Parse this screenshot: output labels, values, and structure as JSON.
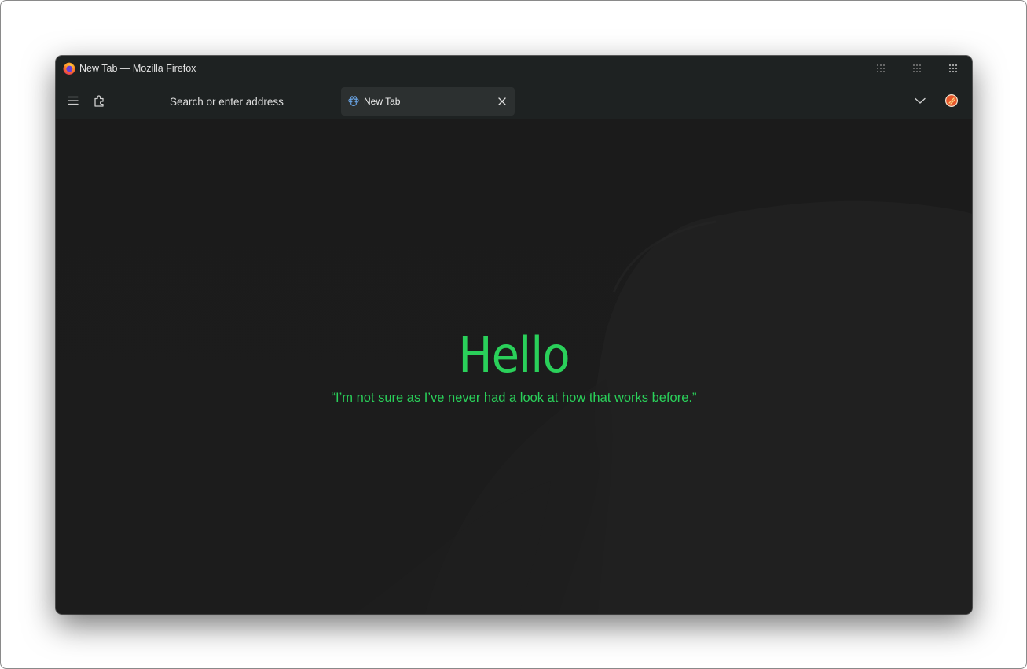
{
  "window": {
    "title": "New Tab — Mozilla Firefox"
  },
  "toolbar": {
    "menu_icon": "hamburger-icon",
    "extensions_icon": "puzzle-icon",
    "url_placeholder": "Search or enter address",
    "list_tabs_icon": "chevron-down-icon",
    "account_icon": "firefox-account-icon"
  },
  "tabs": [
    {
      "label": "New Tab",
      "icon": "paw-icon",
      "close_icon": "close-icon",
      "active": true
    }
  ],
  "newtab": {
    "greeting": "Hello",
    "quote": "“I’m not sure as I’ve never had a look at how that works before.”"
  },
  "colors": {
    "accent_text": "#2ad05a",
    "chrome_bg": "#1e2222",
    "content_bg": "#1b1b1b",
    "tab_bg": "#2c3030"
  }
}
